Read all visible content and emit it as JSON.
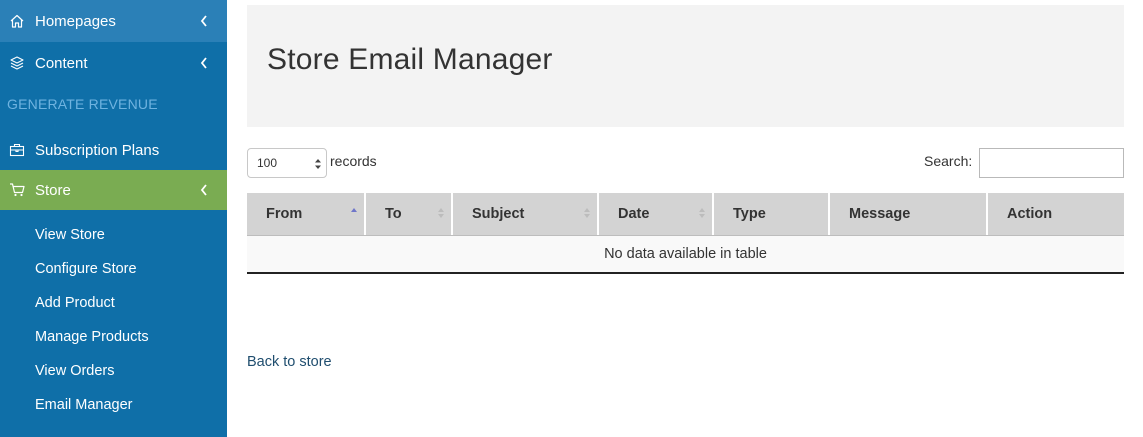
{
  "sidebar": {
    "items": [
      {
        "label": "Homepages",
        "icon": "home-icon"
      },
      {
        "label": "Content",
        "icon": "layers-icon"
      }
    ],
    "section_label": "GENERATE REVENUE",
    "subscription": {
      "label": "Subscription Plans",
      "icon": "briefcase-icon"
    },
    "store": {
      "label": "Store",
      "icon": "cart-icon"
    },
    "store_subitems": [
      "View Store",
      "Configure Store",
      "Add Product",
      "Manage Products",
      "View Orders",
      "Email Manager"
    ],
    "colors": {
      "background": "#0f6fa8",
      "active": "#7aac52",
      "hover": "#2b80b7"
    }
  },
  "main": {
    "title": "Store Email Manager",
    "length_select": {
      "value": "100"
    },
    "records_label": "records",
    "search_label": "Search:",
    "search_value": "",
    "table": {
      "columns": [
        "From",
        "To",
        "Subject",
        "Date",
        "Type",
        "Message",
        "Action"
      ],
      "sorted_column": "From",
      "sort_direction": "ascending",
      "empty_message": "No data available in table"
    },
    "back_link": "Back to store"
  }
}
